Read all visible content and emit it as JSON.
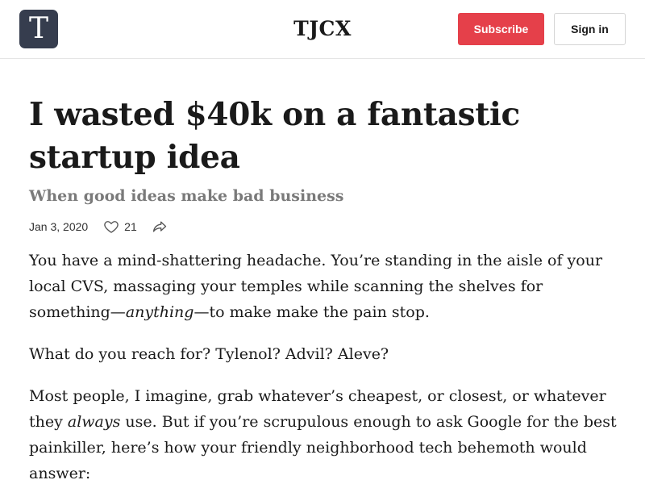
{
  "header": {
    "logo_letter": "T",
    "publication_name": "TJCX",
    "subscribe_label": "Subscribe",
    "signin_label": "Sign in"
  },
  "post": {
    "title": "I wasted $40k on a fantastic startup idea",
    "subtitle": "When good ideas make bad business",
    "date": "Jan 3, 2020",
    "like_count": "21",
    "icons": {
      "like": "heart-icon",
      "share": "share-icon"
    }
  },
  "body": {
    "p1_a": "You have a mind-shattering headache. You’re standing in the aisle of your local CVS, massaging your temples while scanning the shelves for something—",
    "p1_em": "anything",
    "p1_b": "—to make make the pain stop.",
    "p2": "What do you reach for? Tylenol? Advil? Aleve?",
    "p3_a": "Most people, I imagine, grab whatever’s cheapest, or closest, or whatever they ",
    "p3_em": "always",
    "p3_b": " use. But if you’re scrupulous enough to ask Google for the best painkiller, here’s how your friendly neighborhood tech behemoth would answer:"
  },
  "colors": {
    "accent": "#e5404a",
    "logo_bg": "#363d4e",
    "subtitle": "#7a7a7a",
    "divider": "#e5e5e5"
  }
}
